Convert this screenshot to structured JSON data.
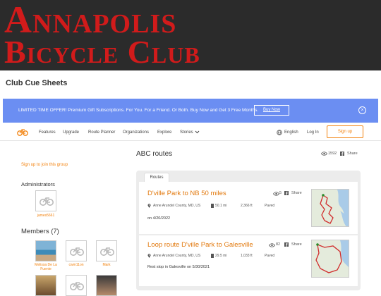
{
  "header": {
    "line1": "Annapolis",
    "line2": "Bicycle Club"
  },
  "page_title": "Club Cue Sheets",
  "promo": {
    "text": "LIMITED TIME OFFER! Premium Gift Subscriptions. For You. For a Friend. Or Both. Buy Now and Get 3 Free Months.",
    "button": "Buy Now",
    "close": "×"
  },
  "nav": {
    "items": [
      "Features",
      "Upgrade",
      "Route Planner",
      "Organizations",
      "Explore",
      "Stories"
    ],
    "language": "English",
    "login": "Log In",
    "signup": "Sign up"
  },
  "sidebar": {
    "join": "Sign up to join this group",
    "admins_heading": "Administrators",
    "admins": [
      "james5661"
    ],
    "members_heading": "Members (7)",
    "members": [
      "Melissa De La Fuente",
      "cwm11on",
      "Mark"
    ]
  },
  "routes": {
    "title": "ABC routes",
    "views": "1592",
    "share": "Share",
    "tab": "Routes",
    "items": [
      {
        "name": "D'ville Park to NB 50 miles",
        "views": "5",
        "share": "Share",
        "location": "Anne Arundel County, MD, US",
        "distance": "50.1 mi",
        "elevation": "2,366 ft",
        "surface": "Paved",
        "note": "on 4/20/2022"
      },
      {
        "name": "Loop route D'ville Park to Galesville",
        "views": "82",
        "share": "Share",
        "location": "Anne Arundel County, MD, US",
        "distance": "29.5 mi",
        "elevation": "1,033 ft",
        "surface": "Paved",
        "note": "Rest stop in Galesville on 5/30/2021"
      }
    ]
  },
  "colors": {
    "brand_red": "#d11b1b",
    "accent_orange": "#f2820e",
    "promo_blue": "#6b8ef2"
  }
}
